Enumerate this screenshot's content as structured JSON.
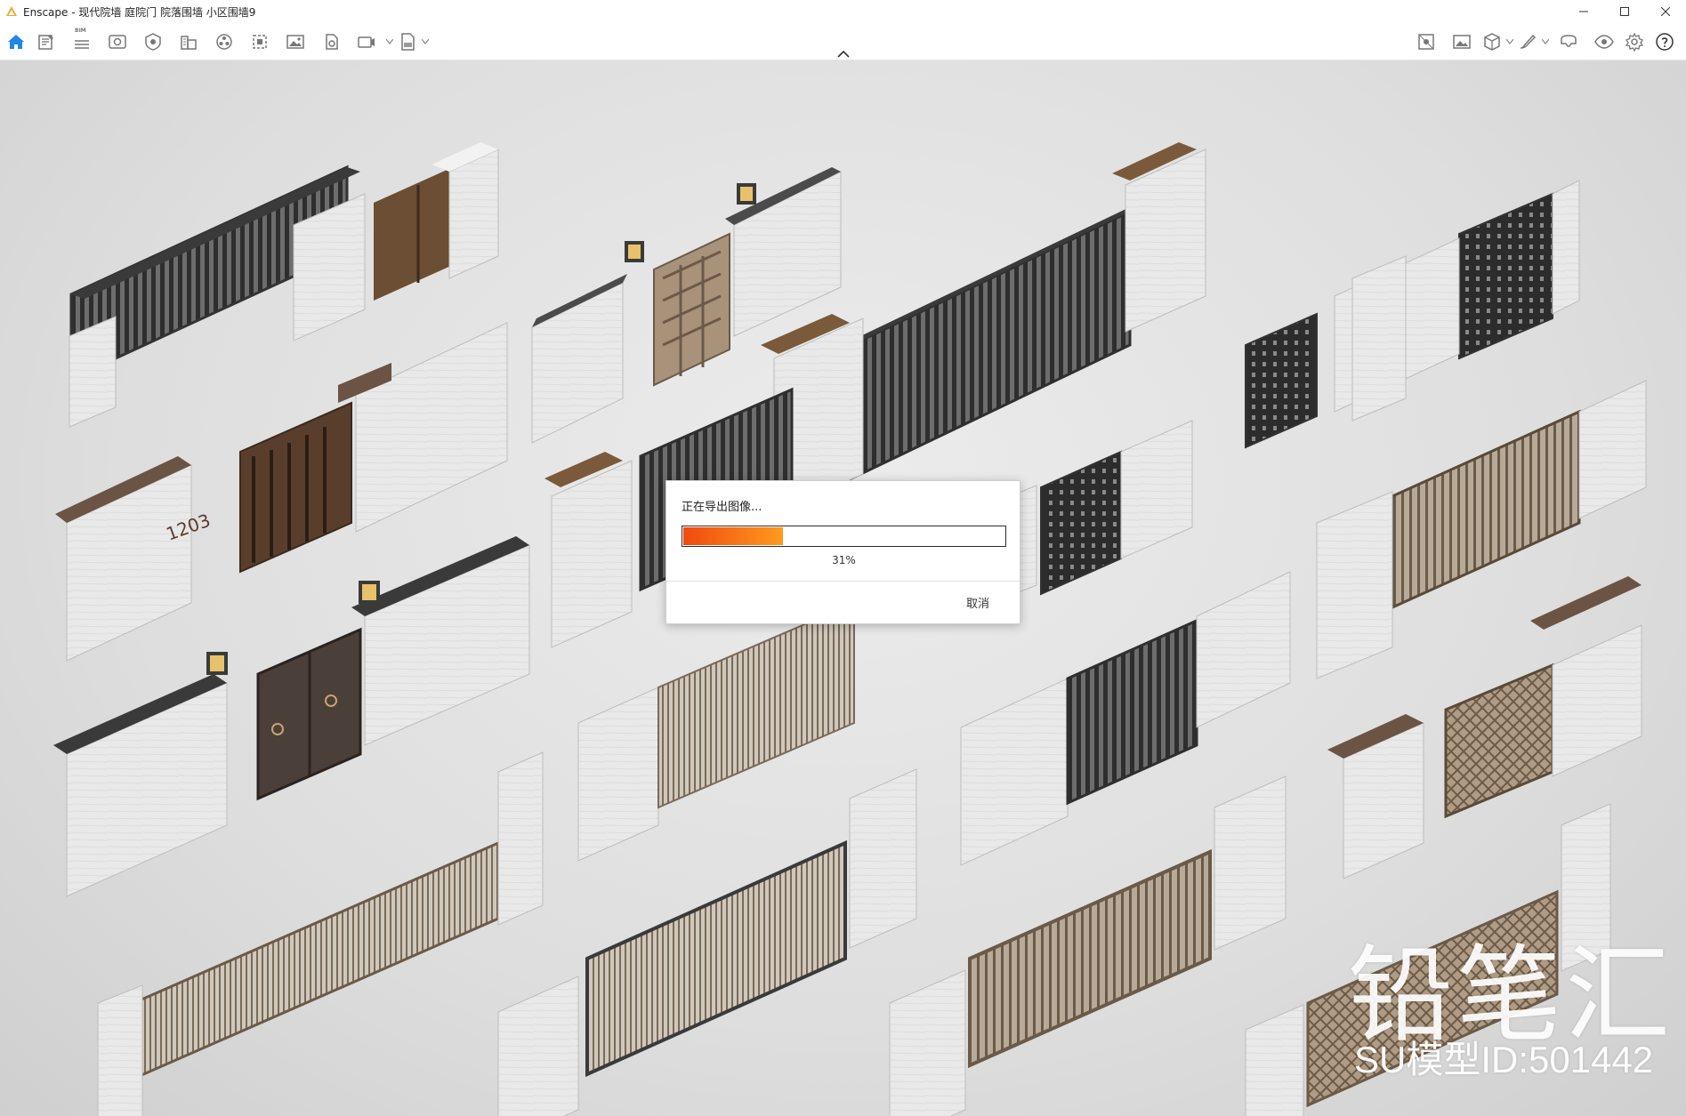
{
  "window": {
    "title": "Enscape - 现代院墙 庭院门 院落围墙 小区围墙9",
    "controls": [
      "minimize-icon",
      "maximize-icon",
      "close-icon"
    ]
  },
  "toolbar": {
    "bim_badge": "BIM",
    "left_icons": [
      "home-icon",
      "notes-icon",
      "bim-list-icon",
      "views-icon",
      "materials-icon",
      "sites-icon",
      "assets-icon",
      "batch-render-icon",
      "screenshot-icon",
      "panorama-icon",
      "video-icon",
      "exe-export-icon"
    ],
    "right_icons": [
      "sun-icon",
      "image-icon",
      "cube-icon",
      "settings-brush-icon",
      "vr-icon",
      "visibility-icon",
      "gear-icon",
      "help-icon"
    ],
    "accent_color": "#1e88e5"
  },
  "watermark": {
    "brand": "铅笔汇",
    "model_id": "SU模型ID:501442"
  },
  "dialog": {
    "title": "正在导出图像...",
    "progress_percent": 31,
    "progress_label": "31%",
    "cancel_label": "取消",
    "progress_colors": [
      "#f04a10",
      "#ff9a1e"
    ]
  }
}
